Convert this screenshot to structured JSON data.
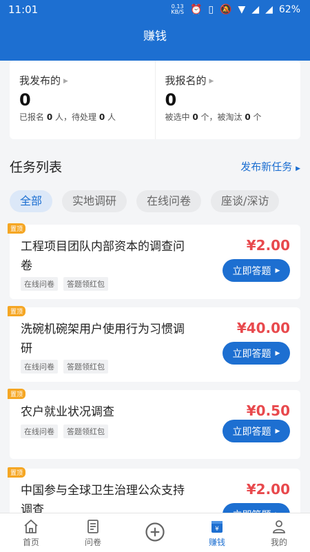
{
  "status": {
    "time": "11:01",
    "net_speed_value": "0.13",
    "net_speed_unit": "KB/S",
    "battery": "62%"
  },
  "header": {
    "title": "赚钱"
  },
  "stats": {
    "published": {
      "label": "我发布的",
      "count": "0",
      "desc_a": "已报名 ",
      "n1": "0",
      "desc_b": " 人，待处理 ",
      "n2": "0",
      "desc_c": " 人"
    },
    "signed": {
      "label": "我报名的",
      "count": "0",
      "desc_a": "被选中 ",
      "n1": "0",
      "desc_b": " 个，被淘汰 ",
      "n2": "0",
      "desc_c": " 个"
    }
  },
  "list": {
    "title": "任务列表",
    "publish_link": "发布新任务"
  },
  "tabs": [
    "全部",
    "实地调研",
    "在线问卷",
    "座谈/深访"
  ],
  "tasks": [
    {
      "pin": "置顶",
      "title": "工程项目团队内部资本的调查问卷",
      "price": "¥2.00",
      "tags": [
        "在线问卷",
        "答题领红包"
      ],
      "button": "立即答题"
    },
    {
      "pin": "置顶",
      "title": "洗碗机碗架用户使用行为习惯调研",
      "price": "¥40.00",
      "tags": [
        "在线问卷",
        "答题领红包"
      ],
      "button": "立即答题"
    },
    {
      "pin": "置顶",
      "title": "农户就业状况调查",
      "price": "¥0.50",
      "tags": [
        "在线问卷",
        "答题领红包"
      ],
      "button": "立即答题"
    },
    {
      "pin": "置顶",
      "title": "中国参与全球卫生治理公众支持调查",
      "price": "¥2.00",
      "tags": [],
      "button": "立即答题"
    }
  ],
  "nav": [
    {
      "label": "首页",
      "icon": "home-icon"
    },
    {
      "label": "问卷",
      "icon": "document-icon"
    },
    {
      "label": "",
      "icon": "plus-circle-icon"
    },
    {
      "label": "赚钱",
      "icon": "wallet-icon"
    },
    {
      "label": "我的",
      "icon": "person-icon"
    }
  ],
  "colors": {
    "primary": "#1d6fd1",
    "price": "#e8494d",
    "pin": "#f5a623"
  }
}
